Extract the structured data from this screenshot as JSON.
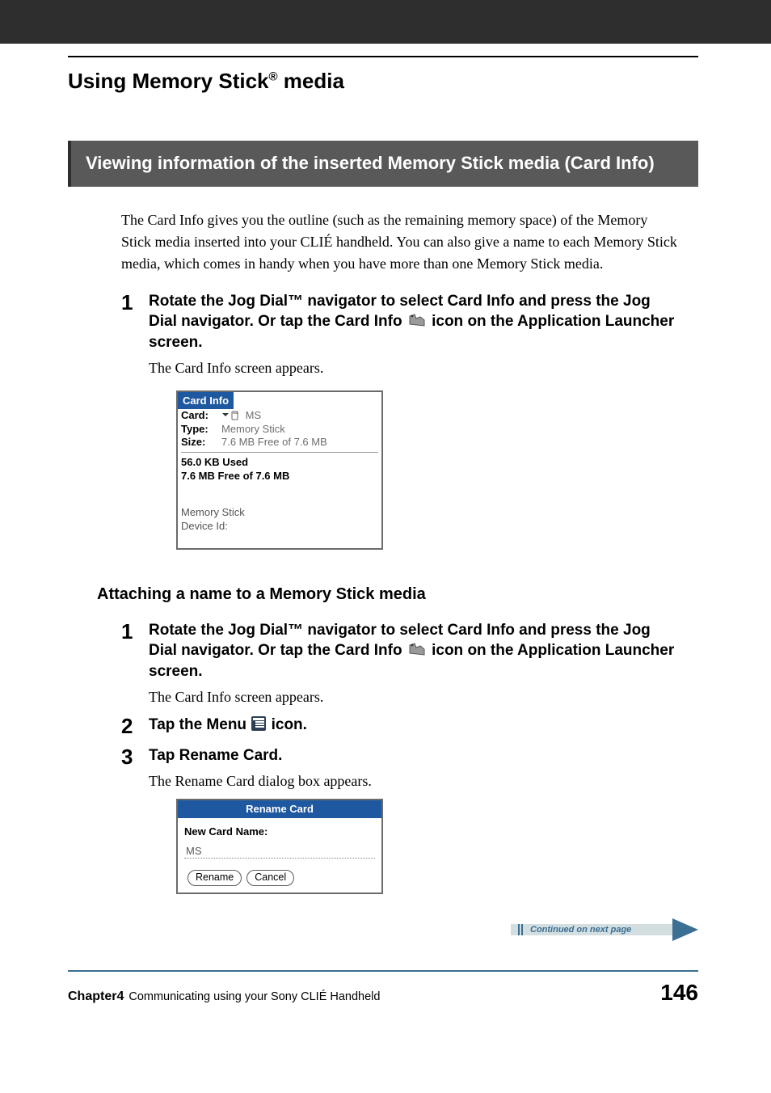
{
  "section_title_pre": "Using Memory Stick",
  "section_title_sup": "®",
  "section_title_post": " media",
  "grey_heading": "Viewing information of the inserted Memory Stick media (Card Info)",
  "intro_paragraph": "The Card Info gives you the outline (such as the remaining memory space) of the Memory Stick media inserted into your CLIÉ handheld. You can also give a name to each Memory Stick media, which comes in handy when you have more than one Memory Stick media.",
  "step1_num": "1",
  "step1_instr_a": "Rotate the Jog Dial™ navigator to select Card Info and press the Jog Dial navigator. Or tap the Card Info ",
  "step1_instr_b": " icon on the Application Launcher screen.",
  "step1_expl": "The Card Info screen appears.",
  "cardinfo": {
    "title": "Card Info",
    "row_card_label": "Card:",
    "row_card_value": "MS",
    "row_type_label": "Type:",
    "row_type_value": "Memory Stick",
    "row_size_label": "Size:",
    "row_size_value": "7.6 MB Free of 7.6 MB",
    "block_used": "56.0 KB Used",
    "block_free": "7.6 MB Free of 7.6 MB",
    "bottom_a": "Memory Stick",
    "bottom_b": "Device Id:"
  },
  "subsection_heading": "Attaching a name to a Memory Stick media",
  "b_step1_num": "1",
  "b_step1_instr_a": "Rotate the Jog Dial™ navigator to select Card Info and press the Jog Dial navigator. Or tap the Card Info ",
  "b_step1_instr_b": " icon on the Application Launcher screen.",
  "b_step1_expl": "The Card Info screen appears.",
  "b_step2_num": "2",
  "b_step2_instr_a": "Tap the Menu ",
  "b_step2_instr_b": " icon.",
  "b_step3_num": "3",
  "b_step3_instr": "Tap Rename Card.",
  "b_step3_expl": "The Rename Card dialog box appears.",
  "rename": {
    "title": "Rename Card",
    "label": "New Card Name:",
    "value": "MS",
    "btn_rename": "Rename",
    "btn_cancel": "Cancel"
  },
  "continued_text": "Continued on next page",
  "footer": {
    "chapter": "Chapter4",
    "chapter_title": "Communicating using your Sony CLIÉ Handheld",
    "page": "146"
  }
}
